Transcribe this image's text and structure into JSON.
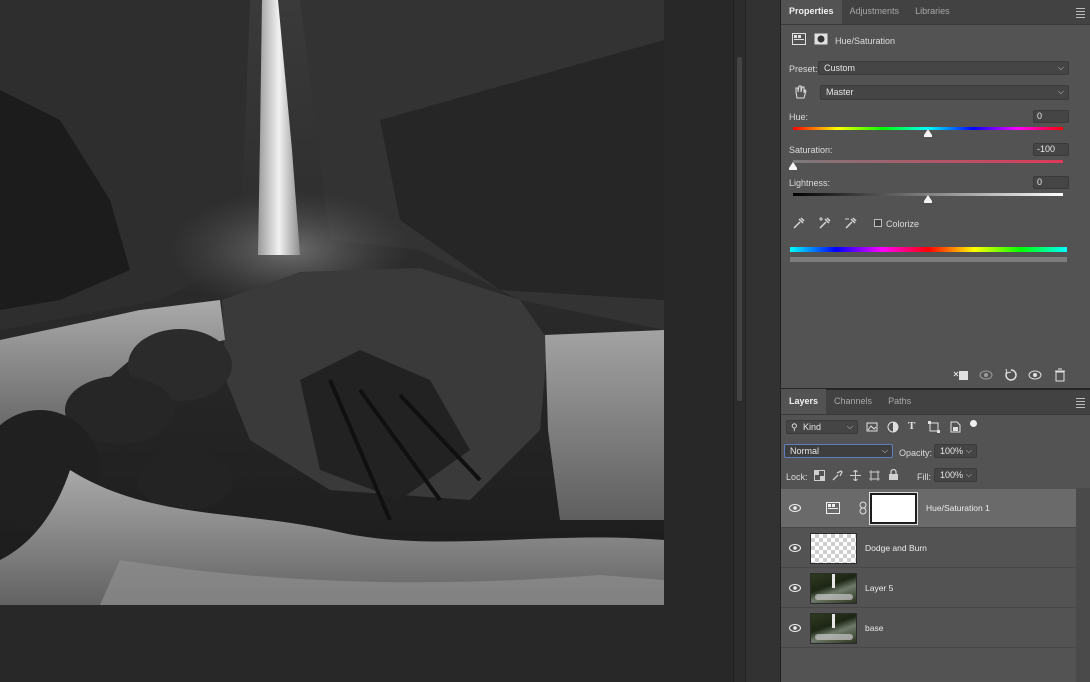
{
  "properties": {
    "tabs": [
      {
        "label": "Properties",
        "active": true
      },
      {
        "label": "Adjustments",
        "active": false
      },
      {
        "label": "Libraries",
        "active": false
      }
    ],
    "adjustment_title": "Hue/Saturation",
    "preset_label": "Preset:",
    "preset_value": "Custom",
    "channel_value": "Master",
    "hue_label": "Hue:",
    "hue_value": "0",
    "saturation_label": "Saturation:",
    "saturation_value": "-100",
    "lightness_label": "Lightness:",
    "lightness_value": "0",
    "colorize_label": "Colorize",
    "colorize_checked": false
  },
  "layers_panel": {
    "tabs": [
      {
        "label": "Layers",
        "active": true
      },
      {
        "label": "Channels",
        "active": false
      },
      {
        "label": "Paths",
        "active": false
      }
    ],
    "filter_kind": "Kind",
    "blend_mode": "Normal",
    "opacity_label": "Opacity:",
    "opacity_value": "100%",
    "lock_label": "Lock:",
    "fill_label": "Fill:",
    "fill_value": "100%",
    "layers": [
      {
        "name": "Hue/Saturation 1",
        "type": "adjustment",
        "selected": true,
        "visible": true
      },
      {
        "name": "Dodge and Burn",
        "type": "transparent",
        "selected": false,
        "visible": true
      },
      {
        "name": "Layer 5",
        "type": "image",
        "selected": false,
        "visible": true
      },
      {
        "name": "base",
        "type": "image",
        "selected": false,
        "visible": true
      }
    ]
  },
  "colors": {
    "panel_bg": "#535353",
    "tab_bar_bg": "#424242",
    "canvas_bg": "#282828",
    "selected_layer_bg": "#6a6a6a",
    "input_bg": "#454545"
  }
}
